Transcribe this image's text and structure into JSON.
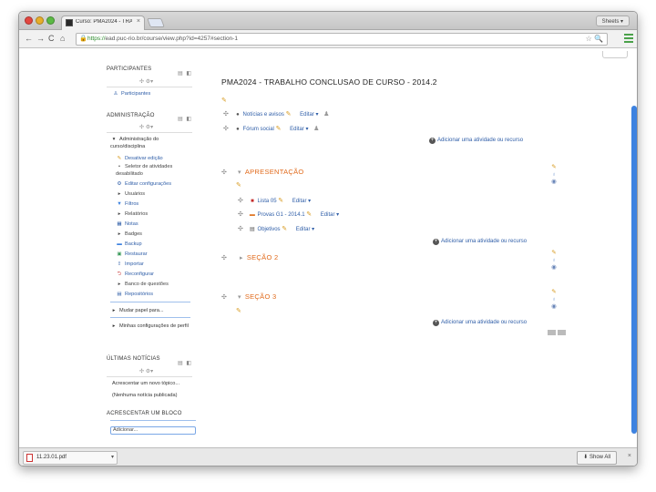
{
  "browser": {
    "tab_title": "Curso: PMA2024 - TRABA...",
    "tab_close": "×",
    "profile_label": "Sheets ▾",
    "nav_back": "←",
    "nav_forward": "→",
    "nav_reload": "C",
    "nav_home": "⌂",
    "url_scheme": "https://",
    "url_rest": "ead.puc-rio.br/course/view.php?id=4257#section-1",
    "star_icon": "☆",
    "zoom_icon": "🔍"
  },
  "sidebar": {
    "participants": {
      "title": "PARTICIPANTES",
      "link": "Participantes"
    },
    "administration": {
      "title": "ADMINISTRAÇÃO",
      "course_admin": "Administração do curso/disciplina",
      "items": [
        {
          "icon": "pencil-icon",
          "glyph": "✎",
          "label": "Desativar edição"
        },
        {
          "icon": "bullet-icon",
          "glyph": "•",
          "label": "Seletor de atividades desabilitado"
        },
        {
          "icon": "gear-icon",
          "glyph": "⚙",
          "label": "Editar configurações"
        },
        {
          "icon": "expand-icon",
          "glyph": "▸",
          "label": "Usuários"
        },
        {
          "icon": "filter-icon",
          "glyph": "▼",
          "label": "Filtros"
        },
        {
          "icon": "expand-icon",
          "glyph": "▸",
          "label": "Relatórios"
        },
        {
          "icon": "grades-icon",
          "glyph": "▦",
          "label": "Notas"
        },
        {
          "icon": "expand-icon",
          "glyph": "▸",
          "label": "Badges"
        },
        {
          "icon": "backup-icon",
          "glyph": "▬",
          "label": "Backup"
        },
        {
          "icon": "restore-icon",
          "glyph": "▣",
          "label": "Restaurar"
        },
        {
          "icon": "import-icon",
          "glyph": "⇪",
          "label": "Importar"
        },
        {
          "icon": "reset-icon",
          "glyph": "⮌",
          "label": "Reconfigurar"
        },
        {
          "icon": "expand-icon",
          "glyph": "▸",
          "label": "Banco de questões"
        },
        {
          "icon": "repository-icon",
          "glyph": "▤",
          "label": "Repositórios"
        }
      ],
      "switch_role": "Mudar papel para...",
      "my_profile": "Minhas configurações de perfil"
    },
    "news": {
      "title": "ÚLTIMAS NOTÍCIAS",
      "add_topic": "Acrescentar um novo tópico...",
      "none": "(Nenhuma notícia publicada)"
    },
    "add_block": {
      "title": "ACRESCENTAR UM BLOCO",
      "select_value": "Adicionar..."
    },
    "block_ctrl": "▤ ◧",
    "block_move": "✣ ⚙▾"
  },
  "course": {
    "title": "PMA2024 - TRABALHO CONCLUSAO DE CURSO - 2014.2",
    "general_activities": [
      {
        "icon": "forum-icon",
        "glyph": "●",
        "label": "Notícias e avisos"
      },
      {
        "icon": "forum-icon",
        "glyph": "●",
        "label": "Fórum social"
      }
    ],
    "edit_label": "Editar ▾",
    "add_activity": "Adicionar uma atividade ou recurso",
    "sections": [
      {
        "title": "APRESENTAÇÃO",
        "activities": [
          {
            "icon": "pdf-file-icon",
            "glyph": "■",
            "label": "Lista 05"
          },
          {
            "icon": "document-icon",
            "glyph": "▬",
            "label": "Provas G1 - 2014.1"
          },
          {
            "icon": "document-icon",
            "glyph": "▤",
            "label": "Objetivos"
          }
        ]
      },
      {
        "title": "SEÇÃO 2"
      },
      {
        "title": "SEÇÃO 3"
      }
    ]
  },
  "download_bar": {
    "file": "11.23.01.pdf",
    "show_all": "Show All",
    "close": "×"
  },
  "colors": {
    "section_title": "#e16a1b",
    "link": "#2f5ea8",
    "pencil": "#d79a1e",
    "scrollbar": "#3d82e0"
  }
}
